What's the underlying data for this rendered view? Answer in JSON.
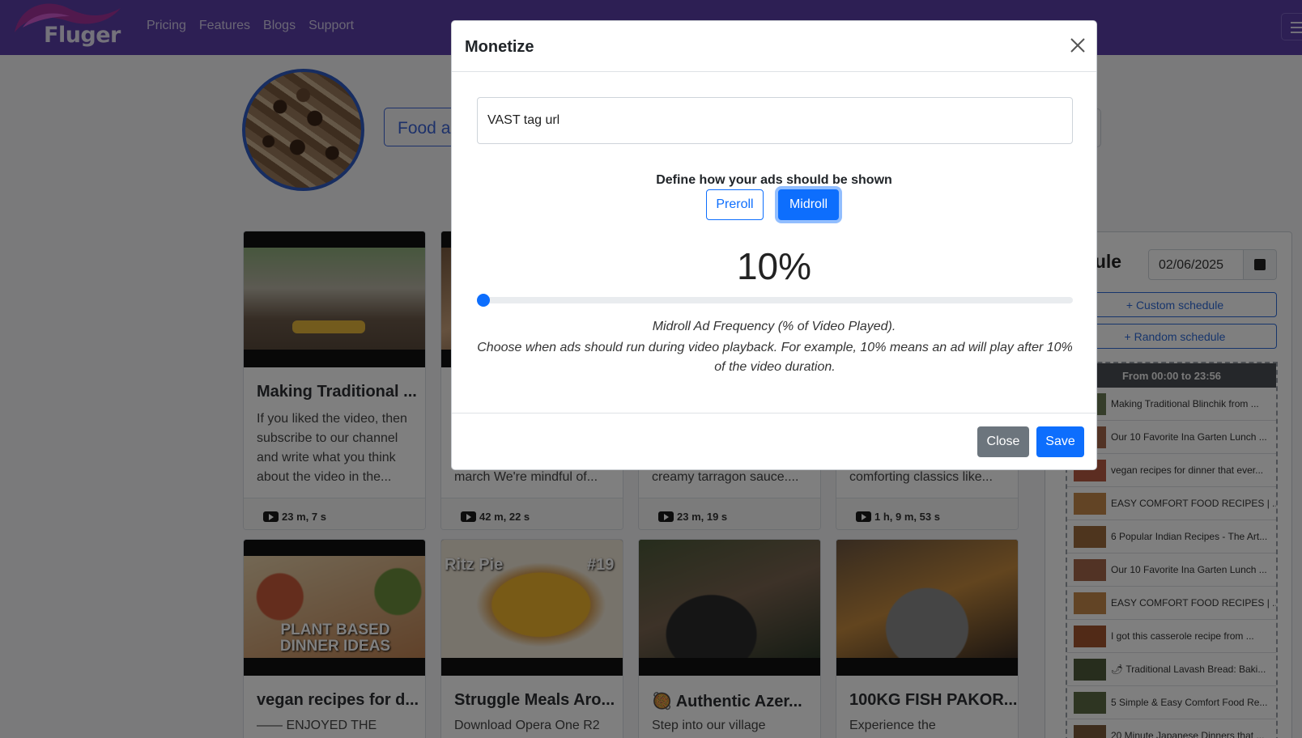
{
  "nav": {
    "logo_text": "Fluger",
    "links": [
      "Pricing",
      "Features",
      "Blogs",
      "Support"
    ]
  },
  "profile": {
    "channel_button": "Food ar"
  },
  "cards_row1": [
    {
      "title": "Making Traditional ...",
      "desc": "If you liked the video, then subscribe to our channel and write what you think about the video in the...",
      "duration": "23 m, 7 s"
    },
    {
      "title": "",
      "desc": "march We're mindful of...",
      "duration": "42 m, 22 s"
    },
    {
      "title": "",
      "desc": "creamy tarragon sauce....",
      "duration": "23 m, 19 s"
    },
    {
      "title": "",
      "desc": "comforting classics like...",
      "duration": "1 h, 9 m, 53 s"
    }
  ],
  "cards_row2": [
    {
      "title": "vegan recipes for d...",
      "desc": "—— ENJOYED THE VIDEO?",
      "thumb_text": "PLANT BASED DINNER IDEAS"
    },
    {
      "title": "Struggle Meals Aro...",
      "desc": "Download Opera One R2",
      "thumb_text_left": "Ritz Pie",
      "thumb_text_right": "#19"
    },
    {
      "title": "Authentic Azer...",
      "desc": "Step into our village",
      "title_emoji": "🥘"
    },
    {
      "title": "100KG FISH PAKOR...",
      "desc": "Experience the"
    }
  ],
  "schedule": {
    "title": "edule",
    "date": "02/06/2025",
    "custom_btn": "+ Custom schedule",
    "random_btn": "+ Random schedule",
    "range": "From 00:00 to 23:56",
    "items": [
      "Making Traditional Blinchik from ...",
      "Our 10 Favorite Ina Garten Lunch ...",
      "vegan recipes for dinner that ever...",
      "EASY COMFORT FOOD RECIPES | ...",
      "6 Popular Indian Recipes - The Art...",
      "Our 10 Favorite Ina Garten Lunch ...",
      "EASY COMFORT FOOD RECIPES | ...",
      "I got this casserole recipe from ...",
      "🌶 Traditional Lavash Bread: Baki...",
      "5 Simple & Easy Comfort Food Re...",
      "20 Minute Japanese Dinners that ..."
    ]
  },
  "modal": {
    "title": "Monetize",
    "vast_placeholder": "VAST tag url",
    "define_label": "Define how your ads should be shown",
    "preroll": "Preroll",
    "midroll": "Midroll",
    "selected_mode": "Midroll",
    "frequency_percent": 10,
    "frequency_display": "10%",
    "freq_label": "Midroll Ad Frequency (% of Video Played).",
    "freq_desc": "Choose when ads should run during video playback. For example, 10% means an ad will play after 10% of the video duration.",
    "close_btn": "Close",
    "save_btn": "Save"
  },
  "colors": {
    "navbar": "#5b3fa8",
    "primary": "#0d6efd",
    "secondary": "#6c757d"
  }
}
